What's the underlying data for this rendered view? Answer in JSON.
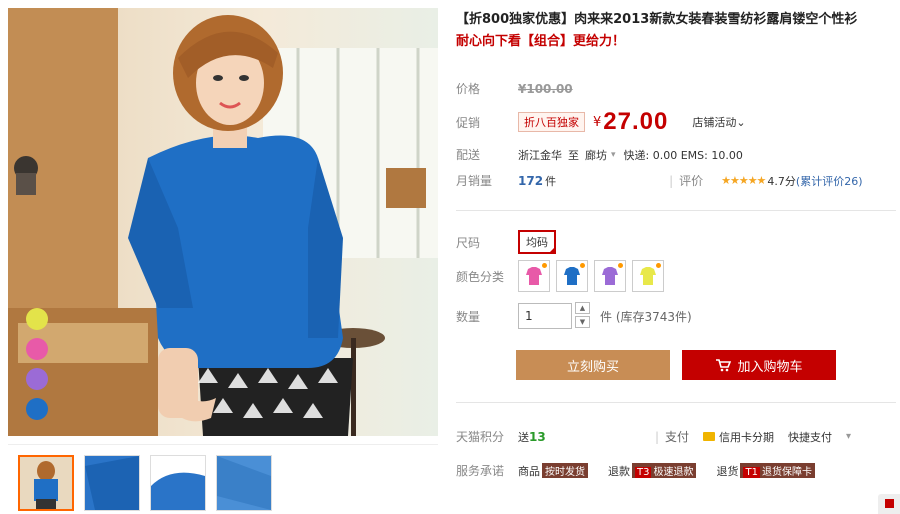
{
  "product": {
    "title": "【折800独家优惠】肉来来2013新款女装春装雪纺衫露肩镂空个性衫",
    "subtitle": "耐心向下看【组合】更给力！"
  },
  "price": {
    "label": "价格",
    "original": "¥100.00",
    "promo_label": "促销",
    "promo_badge": "折八百独家",
    "currency": "¥",
    "current": "27.00",
    "activity": "店铺活动⌄"
  },
  "shipping": {
    "label": "配送",
    "from": "浙江金华",
    "to_word": "至",
    "to": "廊坊",
    "fees": "快递: 0.00  EMS: 10.00"
  },
  "sales": {
    "label": "月销量",
    "count": "172",
    "unit": "件",
    "rating_label": "评价",
    "stars": "★★★★★",
    "score": "4.7分",
    "reviews": "(累计评价26)"
  },
  "size": {
    "label": "尺码",
    "value": "均码"
  },
  "color": {
    "label": "颜色分类",
    "options": [
      "#e85aa8",
      "#1f6fc5",
      "#9b6bd6",
      "#e8e84a"
    ]
  },
  "quantity": {
    "label": "数量",
    "value": "1",
    "unit_stock": "件  (库存3743件)",
    "up": "▲",
    "down": "▼"
  },
  "buttons": {
    "buy": "立刻购买",
    "cart": "加入购物车"
  },
  "points": {
    "label": "天猫积分",
    "send": "送",
    "value": "13",
    "pay_label": "支付",
    "credit": "信用卡分期",
    "quick": "快捷支付",
    "quick_arrow": "▾"
  },
  "service": {
    "label": "服务承诺",
    "goods": "商品",
    "goods_tag": "按时发货",
    "refund": "退款",
    "refund_t3": "T3",
    "refund_tag": "极速退款",
    "return": "退货",
    "return_t1": "T1",
    "return_tag": "退货保障卡"
  },
  "gallery": {
    "dot_colors": [
      "#e3e34a",
      "#e85aa8",
      "#9b6bd6",
      "#1f6fc5"
    ]
  }
}
